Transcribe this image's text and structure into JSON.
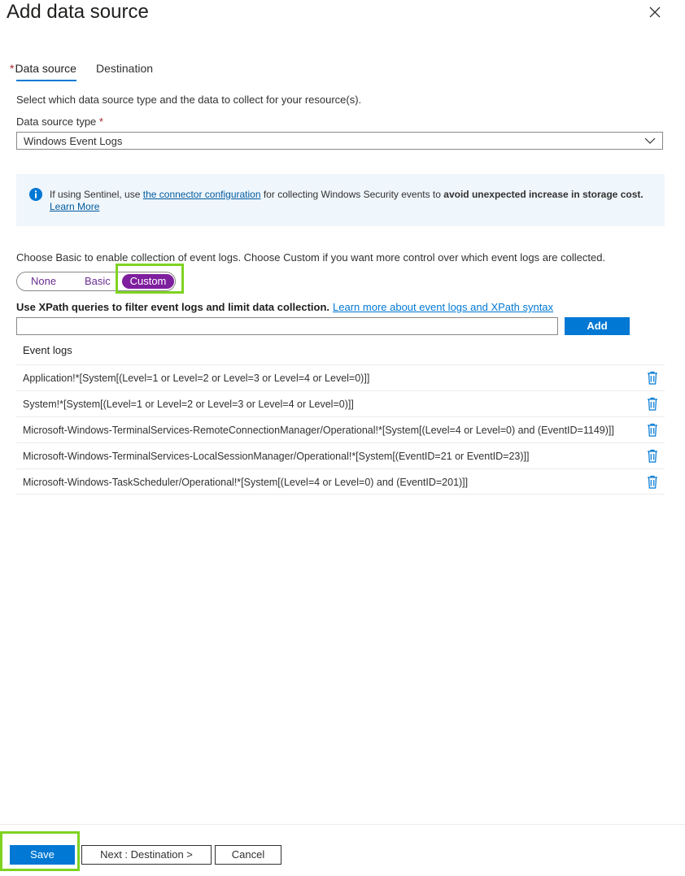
{
  "panel": {
    "title": "Add data source",
    "close_icon": "close-icon"
  },
  "tabs": [
    {
      "label": "Data source",
      "required_marker": "*",
      "active": true
    },
    {
      "label": "Destination",
      "active": false
    }
  ],
  "data_source": {
    "intro": "Select which data source type and the data to collect for your resource(s).",
    "type_label": "Data source type",
    "required_marker": "*",
    "type_value": "Windows Event Logs"
  },
  "info": {
    "icon": "info-icon",
    "prefix": "If using Sentinel, use ",
    "link": "the connector configuration",
    "middle": " for collecting Windows Security events to ",
    "bold": "avoid unexpected increase in storage cost.",
    "learn_more": "Learn More",
    "background": "#eff6fc"
  },
  "collection": {
    "description": "Choose Basic to enable collection of event logs. Choose Custom if you want more control over which event logs are collected.",
    "options": [
      "None",
      "Basic",
      "Custom"
    ],
    "selected": "Custom",
    "accent_color": "#7e1f9e"
  },
  "xpath": {
    "label": "Use XPath queries to filter event logs and limit data collection.",
    "link": "Learn more about event logs and XPath syntax",
    "input_value": "",
    "add_label": "Add"
  },
  "event_logs": {
    "header": "Event logs",
    "rows": [
      "Application!*[System[(Level=1 or Level=2 or Level=3 or Level=4 or Level=0)]]",
      "System!*[System[(Level=1 or Level=2 or Level=3 or Level=4 or Level=0)]]",
      "Microsoft-Windows-TerminalServices-RemoteConnectionManager/Operational!*[System[(Level=4 or Level=0) and (EventID=1149)]]",
      "Microsoft-Windows-TerminalServices-LocalSessionManager/Operational!*[System[(EventID=21 or EventID=23)]]",
      "Microsoft-Windows-TaskScheduler/Operational!*[System[(Level=4 or Level=0) and (EventID=201)]]"
    ],
    "delete_icon": "trash-icon"
  },
  "footer": {
    "save_label": "Save",
    "next_label": "Next : Destination >",
    "cancel_label": "Cancel",
    "primary_color": "#0078d4",
    "highlight_color": "#7ed321"
  }
}
